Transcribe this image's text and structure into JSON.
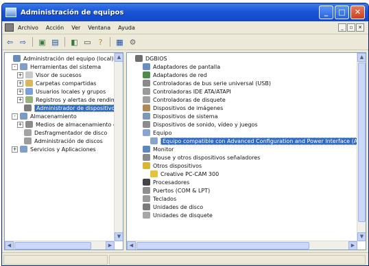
{
  "window": {
    "title": "Administración de equipos"
  },
  "menu": [
    "Archivo",
    "Acción",
    "Ver",
    "Ventana",
    "Ayuda"
  ],
  "toolbar": {
    "icons": [
      "back-arrow-icon",
      "forward-arrow-icon",
      "up-folder-icon",
      "show-hide-tree-icon",
      "export-list-icon",
      "print-icon",
      "help-icon",
      "properties-icon",
      "scan-hardware-icon"
    ]
  },
  "left_tree": [
    {
      "label": "Administración del equipo (local)",
      "level": 0,
      "exp": "",
      "color": "#6b8cb8"
    },
    {
      "label": "Herramientas del sistema",
      "level": 1,
      "exp": "-",
      "color": "#7f9ec9"
    },
    {
      "label": "Visor de sucesos",
      "level": 2,
      "exp": "+",
      "color": "#c8c8c8"
    },
    {
      "label": "Carpetas compartidas",
      "level": 2,
      "exp": "+",
      "color": "#d9b75a"
    },
    {
      "label": "Usuarios locales y grupos",
      "level": 2,
      "exp": "+",
      "color": "#7aa0d6"
    },
    {
      "label": "Registros y alertas de rendimiento",
      "level": 2,
      "exp": "+",
      "color": "#9bb17a"
    },
    {
      "label": "Administrador de dispositivos",
      "level": 2,
      "exp": "",
      "selected": true,
      "color": "#7c7c7c"
    },
    {
      "label": "Almacenamiento",
      "level": 1,
      "exp": "-",
      "color": "#7a9bc5"
    },
    {
      "label": "Medios de almacenamiento extraíbles",
      "level": 2,
      "exp": "+",
      "color": "#8b8b8b"
    },
    {
      "label": "Desfragmentador de disco",
      "level": 2,
      "exp": "",
      "color": "#a3a3a3"
    },
    {
      "label": "Administración de discos",
      "level": 2,
      "exp": "",
      "color": "#9c9c9c"
    },
    {
      "label": "Servicios y Aplicaciones",
      "level": 1,
      "exp": "+",
      "color": "#7e9fc9"
    }
  ],
  "right_tree": [
    {
      "label": "DGBIOS",
      "level": 0,
      "exp": "",
      "color": "#6f6f6f"
    },
    {
      "label": "Adaptadores de pantalla",
      "level": 1,
      "exp": "",
      "color": "#6a8fbf"
    },
    {
      "label": "Adaptadores de red",
      "level": 1,
      "exp": "",
      "color": "#4f8a4f"
    },
    {
      "label": "Controladoras de bus serie universal (USB)",
      "level": 1,
      "exp": "",
      "color": "#8a8a8a"
    },
    {
      "label": "Controladoras IDE ATA/ATAPI",
      "level": 1,
      "exp": "",
      "color": "#9a9a9a"
    },
    {
      "label": "Controladoras de disquete",
      "level": 1,
      "exp": "",
      "color": "#a0a0a0"
    },
    {
      "label": "Dispositivos de imágenes",
      "level": 1,
      "exp": "",
      "color": "#b08858"
    },
    {
      "label": "Dispositivos de sistema",
      "level": 1,
      "exp": "",
      "color": "#8097b8"
    },
    {
      "label": "Dispositivos de sonido, vídeo y juegos",
      "level": 1,
      "exp": "",
      "color": "#8c8c8c"
    },
    {
      "label": "Equipo",
      "level": 1,
      "exp": "",
      "color": "#8aa5cc"
    },
    {
      "label": "Equipo compatible con Advanced Configuration and Power Interface (ACPI)",
      "level": 2,
      "exp": "",
      "selected": true,
      "color": "#8aa5cc"
    },
    {
      "label": "Monitor",
      "level": 1,
      "exp": "",
      "color": "#5f86b8"
    },
    {
      "label": "Mouse y otros dispositivos señaladores",
      "level": 1,
      "exp": "",
      "color": "#8a8a8a"
    },
    {
      "label": "Otros dispositivos",
      "level": 1,
      "exp": "",
      "color": "#d7b637"
    },
    {
      "label": "Creative PC-CAM 300",
      "level": 2,
      "exp": "",
      "color": "#e6c23a"
    },
    {
      "label": "Procesadores",
      "level": 1,
      "exp": "",
      "color": "#444444"
    },
    {
      "label": "Puertos (COM & LPT)",
      "level": 1,
      "exp": "",
      "color": "#8e8e8e"
    },
    {
      "label": "Teclados",
      "level": 1,
      "exp": "",
      "color": "#9a9a9a"
    },
    {
      "label": "Unidades de disco",
      "level": 1,
      "exp": "",
      "color": "#7b7b7b"
    },
    {
      "label": "Unidades de disquete",
      "level": 1,
      "exp": "",
      "color": "#a7a7a7"
    }
  ]
}
